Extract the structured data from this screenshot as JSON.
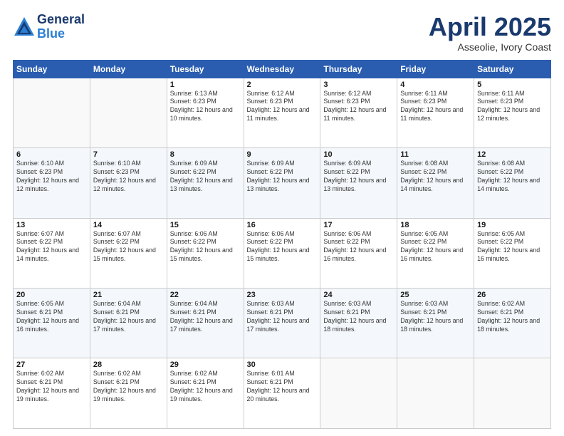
{
  "header": {
    "logo_general": "General",
    "logo_blue": "Blue",
    "title": "April 2025",
    "subtitle": "Asseolie, Ivory Coast"
  },
  "days_of_week": [
    "Sunday",
    "Monday",
    "Tuesday",
    "Wednesday",
    "Thursday",
    "Friday",
    "Saturday"
  ],
  "weeks": [
    [
      {
        "day": "",
        "info": ""
      },
      {
        "day": "",
        "info": ""
      },
      {
        "day": "1",
        "info": "Sunrise: 6:13 AM\nSunset: 6:23 PM\nDaylight: 12 hours and 10 minutes."
      },
      {
        "day": "2",
        "info": "Sunrise: 6:12 AM\nSunset: 6:23 PM\nDaylight: 12 hours and 11 minutes."
      },
      {
        "day": "3",
        "info": "Sunrise: 6:12 AM\nSunset: 6:23 PM\nDaylight: 12 hours and 11 minutes."
      },
      {
        "day": "4",
        "info": "Sunrise: 6:11 AM\nSunset: 6:23 PM\nDaylight: 12 hours and 11 minutes."
      },
      {
        "day": "5",
        "info": "Sunrise: 6:11 AM\nSunset: 6:23 PM\nDaylight: 12 hours and 12 minutes."
      }
    ],
    [
      {
        "day": "6",
        "info": "Sunrise: 6:10 AM\nSunset: 6:23 PM\nDaylight: 12 hours and 12 minutes."
      },
      {
        "day": "7",
        "info": "Sunrise: 6:10 AM\nSunset: 6:23 PM\nDaylight: 12 hours and 12 minutes."
      },
      {
        "day": "8",
        "info": "Sunrise: 6:09 AM\nSunset: 6:22 PM\nDaylight: 12 hours and 13 minutes."
      },
      {
        "day": "9",
        "info": "Sunrise: 6:09 AM\nSunset: 6:22 PM\nDaylight: 12 hours and 13 minutes."
      },
      {
        "day": "10",
        "info": "Sunrise: 6:09 AM\nSunset: 6:22 PM\nDaylight: 12 hours and 13 minutes."
      },
      {
        "day": "11",
        "info": "Sunrise: 6:08 AM\nSunset: 6:22 PM\nDaylight: 12 hours and 14 minutes."
      },
      {
        "day": "12",
        "info": "Sunrise: 6:08 AM\nSunset: 6:22 PM\nDaylight: 12 hours and 14 minutes."
      }
    ],
    [
      {
        "day": "13",
        "info": "Sunrise: 6:07 AM\nSunset: 6:22 PM\nDaylight: 12 hours and 14 minutes."
      },
      {
        "day": "14",
        "info": "Sunrise: 6:07 AM\nSunset: 6:22 PM\nDaylight: 12 hours and 15 minutes."
      },
      {
        "day": "15",
        "info": "Sunrise: 6:06 AM\nSunset: 6:22 PM\nDaylight: 12 hours and 15 minutes."
      },
      {
        "day": "16",
        "info": "Sunrise: 6:06 AM\nSunset: 6:22 PM\nDaylight: 12 hours and 15 minutes."
      },
      {
        "day": "17",
        "info": "Sunrise: 6:06 AM\nSunset: 6:22 PM\nDaylight: 12 hours and 16 minutes."
      },
      {
        "day": "18",
        "info": "Sunrise: 6:05 AM\nSunset: 6:22 PM\nDaylight: 12 hours and 16 minutes."
      },
      {
        "day": "19",
        "info": "Sunrise: 6:05 AM\nSunset: 6:22 PM\nDaylight: 12 hours and 16 minutes."
      }
    ],
    [
      {
        "day": "20",
        "info": "Sunrise: 6:05 AM\nSunset: 6:21 PM\nDaylight: 12 hours and 16 minutes."
      },
      {
        "day": "21",
        "info": "Sunrise: 6:04 AM\nSunset: 6:21 PM\nDaylight: 12 hours and 17 minutes."
      },
      {
        "day": "22",
        "info": "Sunrise: 6:04 AM\nSunset: 6:21 PM\nDaylight: 12 hours and 17 minutes."
      },
      {
        "day": "23",
        "info": "Sunrise: 6:03 AM\nSunset: 6:21 PM\nDaylight: 12 hours and 17 minutes."
      },
      {
        "day": "24",
        "info": "Sunrise: 6:03 AM\nSunset: 6:21 PM\nDaylight: 12 hours and 18 minutes."
      },
      {
        "day": "25",
        "info": "Sunrise: 6:03 AM\nSunset: 6:21 PM\nDaylight: 12 hours and 18 minutes."
      },
      {
        "day": "26",
        "info": "Sunrise: 6:02 AM\nSunset: 6:21 PM\nDaylight: 12 hours and 18 minutes."
      }
    ],
    [
      {
        "day": "27",
        "info": "Sunrise: 6:02 AM\nSunset: 6:21 PM\nDaylight: 12 hours and 19 minutes."
      },
      {
        "day": "28",
        "info": "Sunrise: 6:02 AM\nSunset: 6:21 PM\nDaylight: 12 hours and 19 minutes."
      },
      {
        "day": "29",
        "info": "Sunrise: 6:02 AM\nSunset: 6:21 PM\nDaylight: 12 hours and 19 minutes."
      },
      {
        "day": "30",
        "info": "Sunrise: 6:01 AM\nSunset: 6:21 PM\nDaylight: 12 hours and 20 minutes."
      },
      {
        "day": "",
        "info": ""
      },
      {
        "day": "",
        "info": ""
      },
      {
        "day": "",
        "info": ""
      }
    ]
  ]
}
